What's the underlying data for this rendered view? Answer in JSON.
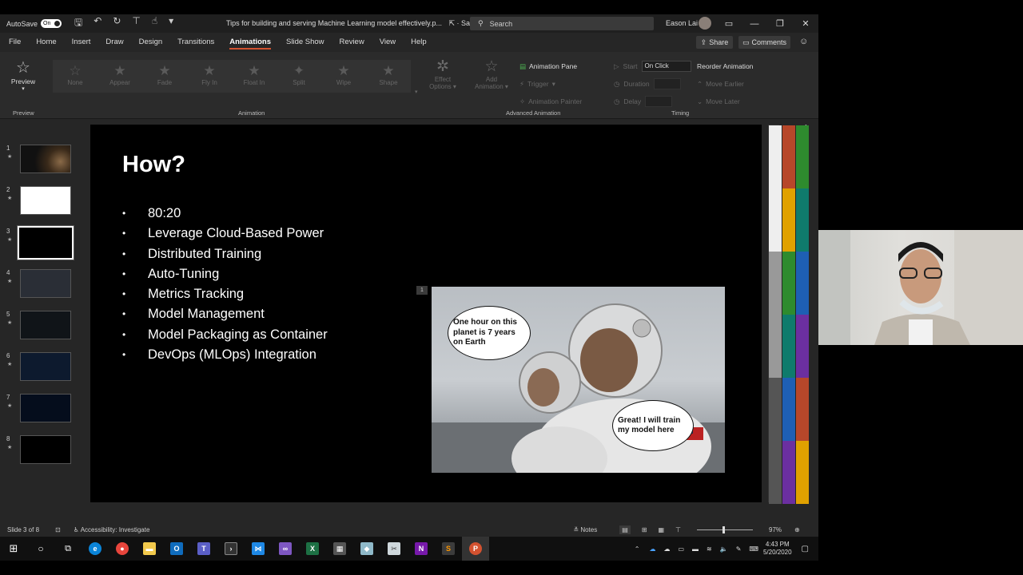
{
  "titlebar": {
    "autosave_label": "AutoSave",
    "autosave_state": "On",
    "doc_title": "Tips for building and serving Machine Learning model effectively.p...",
    "saved_status": "Saved",
    "search_placeholder": "Search",
    "user_name": "Eason Lai"
  },
  "tabs": [
    {
      "label": "File"
    },
    {
      "label": "Home"
    },
    {
      "label": "Insert"
    },
    {
      "label": "Draw"
    },
    {
      "label": "Design"
    },
    {
      "label": "Transitions"
    },
    {
      "label": "Animations"
    },
    {
      "label": "Slide Show"
    },
    {
      "label": "Review"
    },
    {
      "label": "View"
    },
    {
      "label": "Help"
    }
  ],
  "active_tab": "Animations",
  "share_label": "Share",
  "comments_label": "Comments",
  "ribbon": {
    "preview_label": "Preview",
    "preview_group": "Preview",
    "animation_group": "Animation",
    "gallery": [
      {
        "label": "None"
      },
      {
        "label": "Appear"
      },
      {
        "label": "Fade"
      },
      {
        "label": "Fly In"
      },
      {
        "label": "Float In"
      },
      {
        "label": "Split"
      },
      {
        "label": "Wipe"
      },
      {
        "label": "Shape"
      }
    ],
    "effect_options_1": "Effect",
    "effect_options_2": "Options",
    "add_animation_1": "Add",
    "add_animation_2": "Animation",
    "animation_pane": "Animation Pane",
    "trigger": "Trigger",
    "animation_painter": "Animation Painter",
    "advanced_group": "Advanced Animation",
    "start_label": "Start",
    "start_value": "On Click",
    "duration_label": "Duration",
    "delay_label": "Delay",
    "reorder_label": "Reorder Animation",
    "move_earlier": "Move Earlier",
    "move_later": "Move Later",
    "timing_group": "Timing"
  },
  "thumbnails": [
    {
      "num": "1"
    },
    {
      "num": "2"
    },
    {
      "num": "3"
    },
    {
      "num": "4"
    },
    {
      "num": "5"
    },
    {
      "num": "6"
    },
    {
      "num": "7"
    },
    {
      "num": "8"
    }
  ],
  "slide": {
    "title": "How?",
    "bullets": [
      "80:20",
      "Leverage Cloud-Based Power",
      "Distributed Training",
      "Auto-Tuning",
      "Metrics Tracking",
      "Model Management",
      "Model Packaging as Container",
      "DevOps (MLOps) Integration"
    ],
    "anim_tag": "1",
    "bubble_left": "One hour on this planet is 7 years on Earth",
    "bubble_right": "Great! I will train my model here"
  },
  "status": {
    "slide_info": "Slide 3 of 8",
    "accessibility": "Accessibility: Investigate",
    "notes": "Notes",
    "zoom": "97%"
  },
  "taskbar": {
    "time": "4:43 PM",
    "date": "5/20/2020"
  },
  "colors": {
    "accent": "#d35230",
    "ribbon_bg": "#2b2b2b",
    "strip_colors": [
      "#eeeeee",
      "#b7472a",
      "#e0a100",
      "#2e8b2e",
      "#0f7b6c",
      "#1e5fb4",
      "#6b2fa0"
    ]
  }
}
